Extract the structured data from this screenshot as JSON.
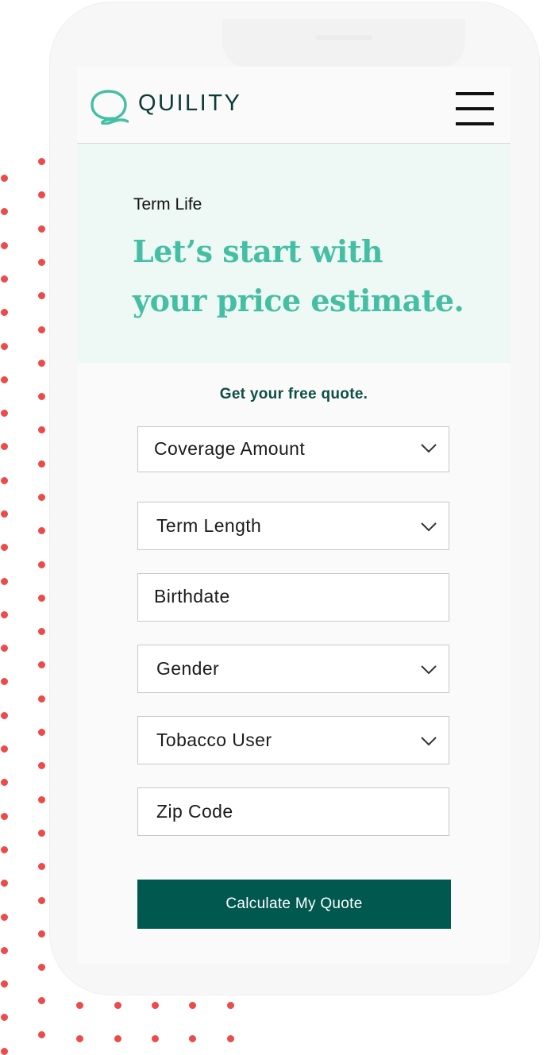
{
  "brand": {
    "name": "QUILITY",
    "logo_icon": "quility-q-icon",
    "primary_color": "#01584f",
    "accent_color": "#45bfa3",
    "hero_bg_color": "#eef8f5",
    "decor_dot_color": "#ec4b4b"
  },
  "nav": {
    "menu_icon": "hamburger-menu-icon"
  },
  "hero": {
    "eyebrow": "Term Life",
    "headline_line1": "Let’s start with",
    "headline_line2": "your price estimate."
  },
  "form": {
    "title": "Get your free quote.",
    "fields": [
      {
        "label": "Coverage Amount",
        "type": "select",
        "icon": "chevron-down-icon"
      },
      {
        "label": "Term Length",
        "type": "select",
        "icon": "chevron-down-icon"
      },
      {
        "label": "Birthdate",
        "type": "input"
      },
      {
        "label": "Gender",
        "type": "select",
        "icon": "chevron-down-icon"
      },
      {
        "label": "Tobacco User",
        "type": "select",
        "icon": "chevron-down-icon"
      },
      {
        "label": "Zip Code",
        "type": "input"
      }
    ],
    "submit_label": "Calculate My Quote"
  }
}
